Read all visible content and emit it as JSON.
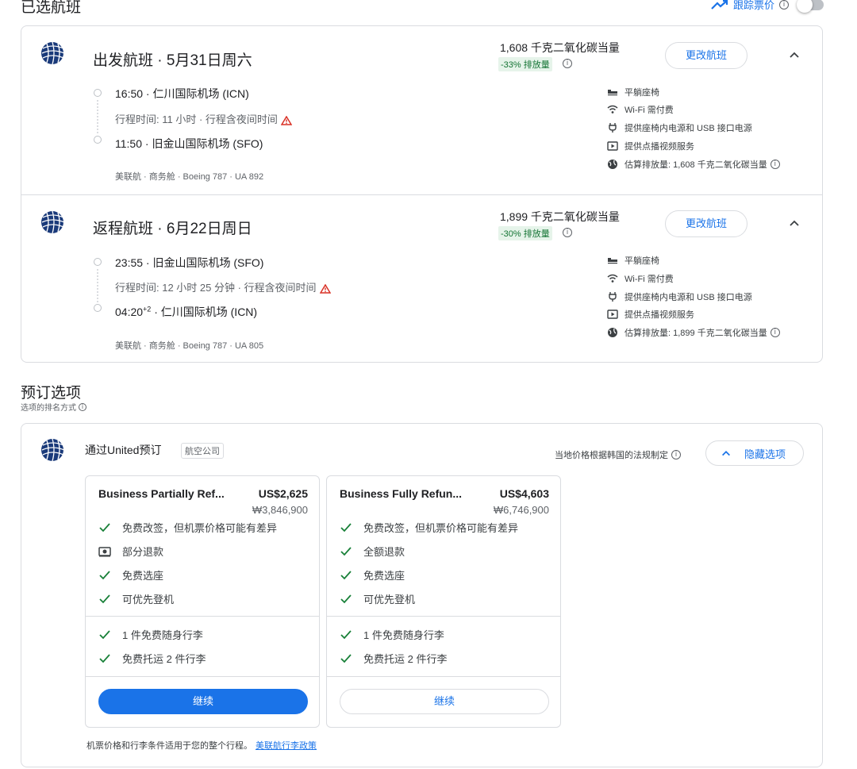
{
  "header": {
    "title": "已选航班",
    "track_label": "跟踪票价",
    "track_enabled": false
  },
  "colors": {
    "accent": "#1a73e8",
    "eco_green": "#137333",
    "eco_bg": "#e6f4ea",
    "warning": "#d93025",
    "united_blue": "#1a3a7a"
  },
  "flights": [
    {
      "title": "出发航班 · 5月31日周六",
      "co2": "1,608 千克二氧化碳当量",
      "co2_badge": "-33% 排放量",
      "change_label": "更改航班",
      "depart": "16:50 · 仁川国际机场 (ICN)",
      "duration": "行程时间: 11 小时 · 行程含夜间时间",
      "arrive_time": "11:50",
      "arrive_sup": "",
      "arrive_airport": " · 旧金山国际机场 (SFO)",
      "meta": "美联航 · 商务舱 · Boeing 787 · UA 892",
      "amenities": [
        "平躺座椅",
        "Wi-Fi 需付费",
        "提供座椅内电源和 USB 接口电源",
        "提供点播视频服务",
        "估算排放量: 1,608 千克二氧化碳当量"
      ]
    },
    {
      "title": "返程航班 · 6月22日周日",
      "co2": "1,899 千克二氧化碳当量",
      "co2_badge": "-30% 排放量",
      "change_label": "更改航班",
      "depart": "23:55 · 旧金山国际机场 (SFO)",
      "duration": "行程时间: 12 小时 25 分钟 · 行程含夜间时间",
      "arrive_time": "04:20",
      "arrive_sup": "+2",
      "arrive_airport": " · 仁川国际机场 (ICN)",
      "meta": "美联航 · 商务舱 · Boeing 787 · UA 805",
      "amenities": [
        "平躺座椅",
        "Wi-Fi 需付费",
        "提供座椅内电源和 USB 接口电源",
        "提供点播视频服务",
        "估算排放量: 1,899 千克二氧化碳当量"
      ]
    }
  ],
  "booking": {
    "title": "预订选项",
    "subtitle": "选项的排名方式",
    "via": "通过United预订",
    "airline_tag": "航空公司",
    "law_note": "当地价格根据韩国的法规制定",
    "hide_label": "隐藏选项",
    "options": [
      {
        "name": "Business Partially Ref...",
        "price": "US$2,625",
        "krw": "₩3,846,900",
        "features": [
          "免费改签，但机票价格可能有差异",
          "部分退款",
          "免费选座",
          "可优先登机"
        ],
        "feature_icons": [
          "check-icon",
          "money-icon",
          "check-icon",
          "check-icon"
        ],
        "baggage": [
          "1 件免费随身行李",
          "免费托运 2 件行李"
        ],
        "continue_label": "继续"
      },
      {
        "name": "Business Fully Refun...",
        "price": "US$4,603",
        "krw": "₩6,746,900",
        "features": [
          "免费改签，但机票价格可能有差异",
          "全额退款",
          "免费选座",
          "可优先登机"
        ],
        "feature_icons": [
          "check-icon",
          "check-icon",
          "check-icon",
          "check-icon"
        ],
        "baggage": [
          "1 件免费随身行李",
          "免费托运 2 件行李"
        ],
        "continue_label": "继续"
      }
    ],
    "footer_note": "机票价格和行李条件适用于您的整个行程。",
    "footer_link": "美联航行李政策"
  }
}
